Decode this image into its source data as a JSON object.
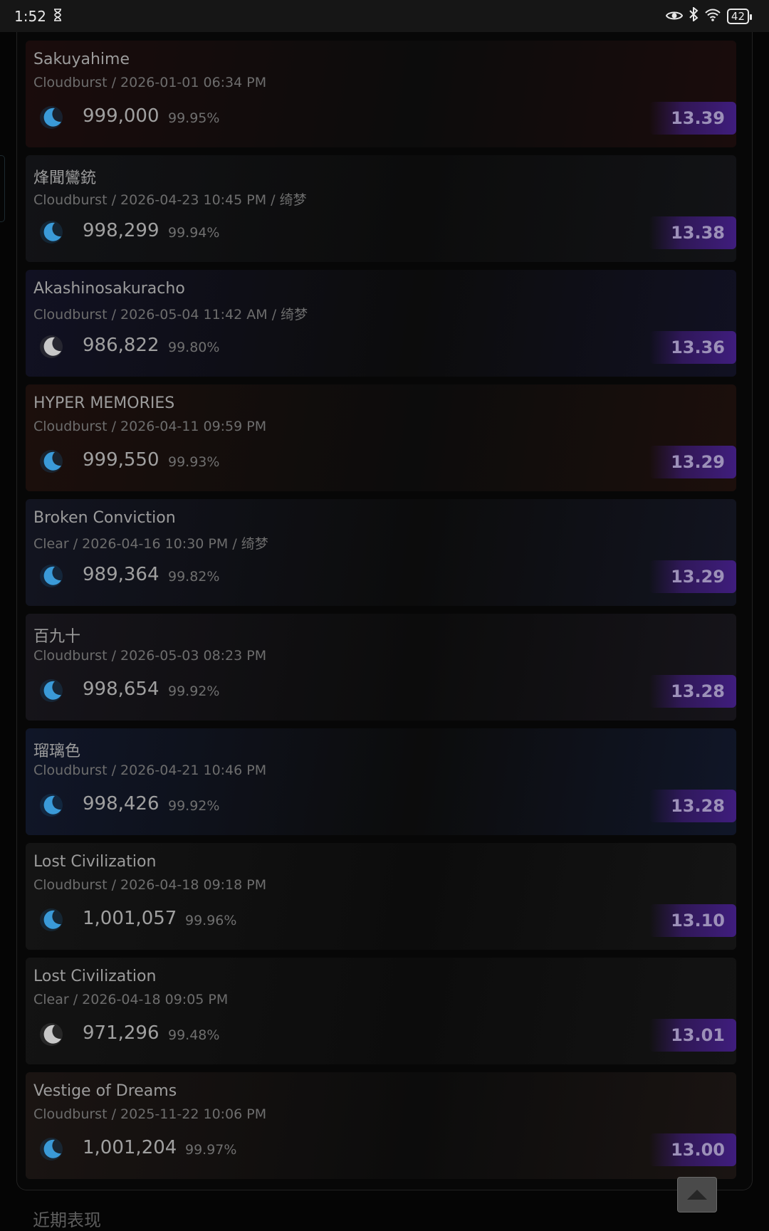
{
  "status_bar": {
    "time": "1:52",
    "battery": "42"
  },
  "records": [
    {
      "title": "Sakuyahime",
      "meta": "Cloudburst / 2026-01-01 06:34 PM",
      "score": "999,000",
      "accuracy": "99.95%",
      "rating": "13.39",
      "icon": "moon-icon-blue",
      "bg": "#1a0c0c"
    },
    {
      "title": "烽聞鸞銃",
      "meta": "Cloudburst / 2026-04-23 10:45 PM / 绮梦",
      "score": "998,299",
      "accuracy": "99.94%",
      "rating": "13.38",
      "icon": "moon-icon-blue",
      "bg": "#121316"
    },
    {
      "title": "Akashinosakuracho",
      "meta": "Cloudburst / 2026-05-04 11:42 AM / 绮梦",
      "score": "986,822",
      "accuracy": "99.80%",
      "rating": "13.36",
      "icon": "moon-icon-white",
      "bg": "#111122"
    },
    {
      "title": "HYPER MEMORIES",
      "meta": "Cloudburst / 2026-04-11 09:59 PM",
      "score": "999,550",
      "accuracy": "99.93%",
      "rating": "13.29",
      "icon": "moon-icon-blue",
      "bg": "#1c0f0c"
    },
    {
      "title": "Broken Conviction",
      "meta": "Clear / 2026-04-16 10:30 PM / 绮梦",
      "score": "989,364",
      "accuracy": "99.82%",
      "rating": "13.29",
      "icon": "moon-icon-blue",
      "bg": "#121420"
    },
    {
      "title": "百九十",
      "meta": "Cloudburst / 2026-05-03 08:23 PM",
      "score": "998,654",
      "accuracy": "99.92%",
      "rating": "13.28",
      "icon": "moon-icon-blue",
      "bg": "#16141a"
    },
    {
      "title": "瑠璃色",
      "meta": "Cloudburst / 2026-04-21 10:46 PM",
      "score": "998,426",
      "accuracy": "99.92%",
      "rating": "13.28",
      "icon": "moon-icon-blue",
      "bg": "#101628"
    },
    {
      "title": "Lost Civilization",
      "meta": "Cloudburst / 2026-04-18 09:18 PM",
      "score": "1,001,057",
      "accuracy": "99.96%",
      "rating": "13.10",
      "icon": "moon-icon-blue",
      "bg": "#141414"
    },
    {
      "title": "Lost Civilization",
      "meta": "Clear / 2026-04-18 09:05 PM",
      "score": "971,296",
      "accuracy": "99.48%",
      "rating": "13.01",
      "icon": "moon-icon-white",
      "bg": "#131313"
    },
    {
      "title": "Vestige of Dreams",
      "meta": "Cloudburst / 2025-11-22 10:06 PM",
      "score": "1,001,204",
      "accuracy": "99.97%",
      "rating": "13.00",
      "icon": "moon-icon-blue",
      "bg": "#1a1412"
    }
  ],
  "section_title": "近期表现"
}
